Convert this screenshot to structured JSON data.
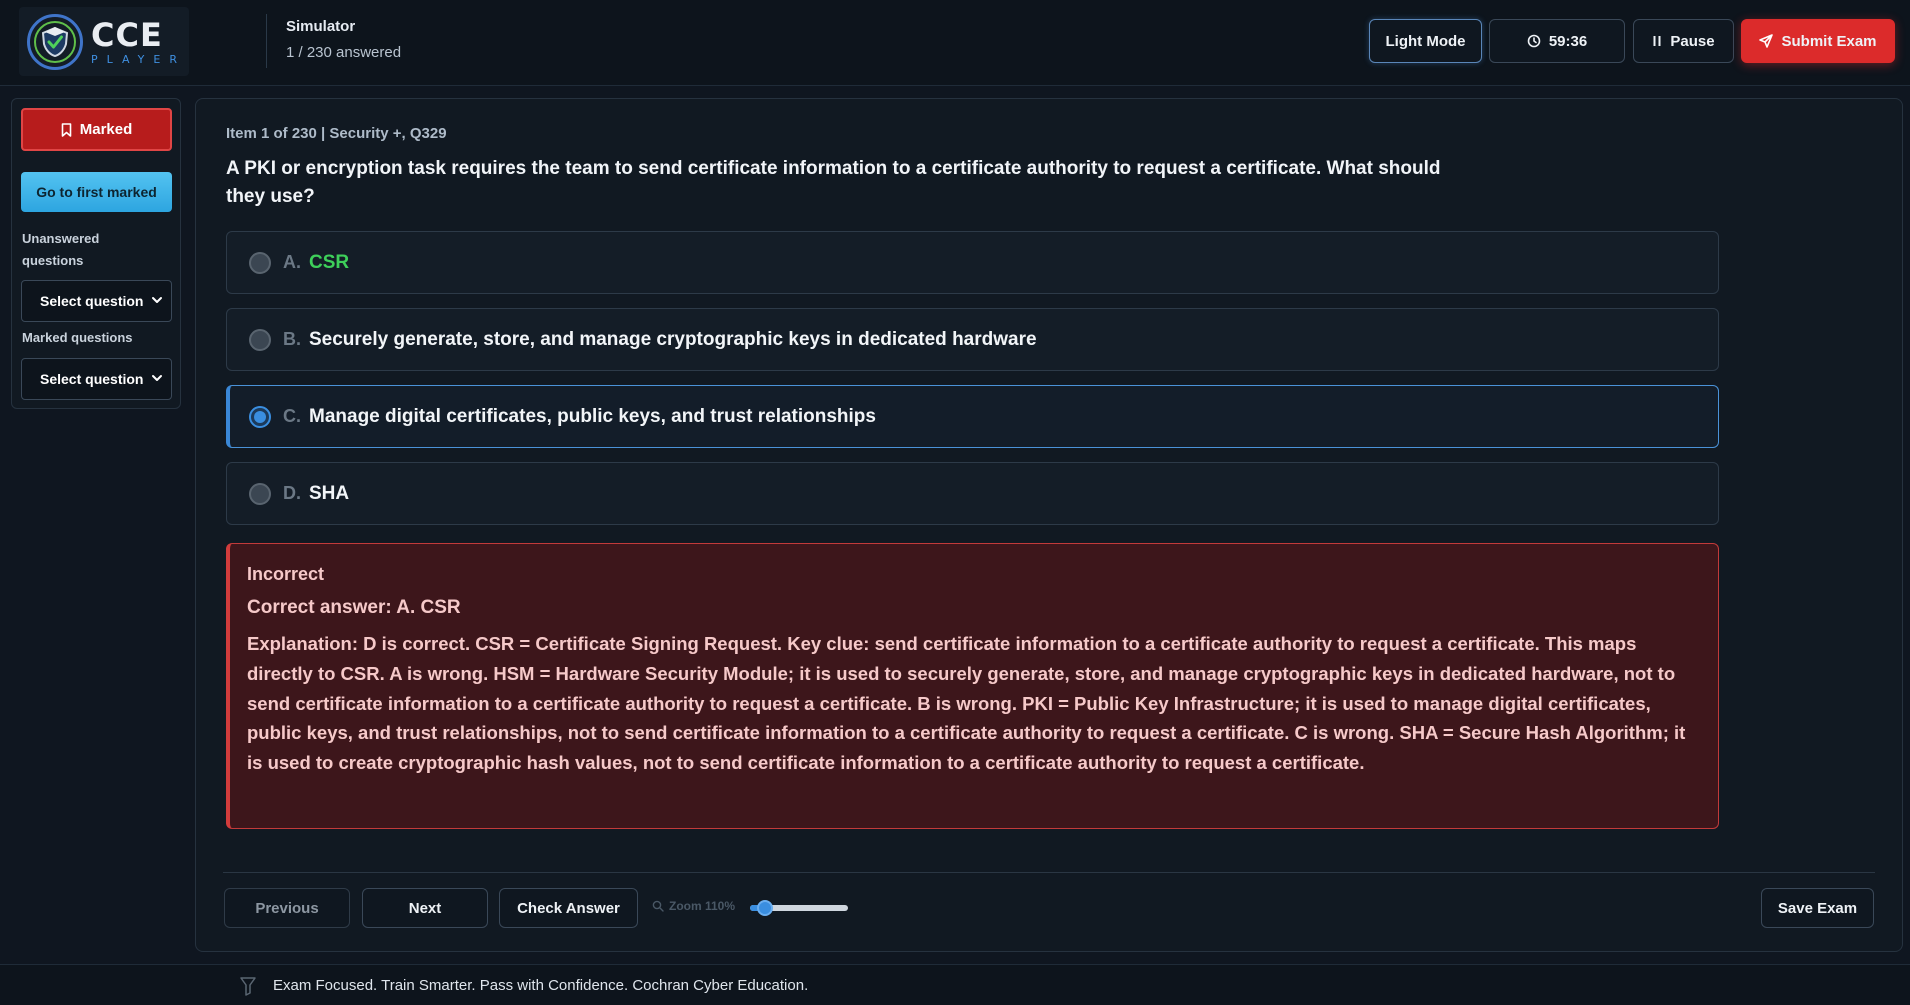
{
  "header": {
    "logo_text": "CCE",
    "logo_subtext": "PLAYER",
    "title": "Simulator",
    "progress": "1 / 230 answered",
    "light_mode_label": "Light Mode",
    "timer": "59:36",
    "pause_label": "Pause",
    "submit_label": "Submit Exam"
  },
  "sidebar": {
    "marked_label": "Marked",
    "first_marked_label": "Go to first marked",
    "unanswered_label": "Unanswered questions",
    "unanswered_select": "Select question",
    "marked_questions_label": "Marked questions",
    "marked_select": "Select question"
  },
  "question": {
    "meta": "Item 1 of 230 | Security +, Q329",
    "text": "A PKI or encryption task requires the team to send certificate information to a certificate authority to request a certificate. What should they use?",
    "options": [
      {
        "letter": "A.",
        "text": "CSR",
        "state": "correct"
      },
      {
        "letter": "B.",
        "text": "Securely generate, store, and manage cryptographic keys in dedicated hardware",
        "state": "normal"
      },
      {
        "letter": "C.",
        "text": "Manage digital certificates, public keys, and trust relationships",
        "state": "selected"
      },
      {
        "letter": "D.",
        "text": "SHA",
        "state": "normal"
      }
    ]
  },
  "feedback": {
    "status": "Incorrect",
    "correct_answer": "Correct answer: A. CSR",
    "explanation": "Explanation: D is correct. CSR = Certificate Signing Request. Key clue: send certificate information to a certificate authority to request a certificate. This maps directly to CSR. A is wrong. HSM = Hardware Security Module; it is used to securely generate, store, and manage cryptographic keys in dedicated hardware, not to send certificate information to a certificate authority to request a certificate. B is wrong. PKI = Public Key Infrastructure; it is used to manage digital certificates, public keys, and trust relationships, not to send certificate information to a certificate authority to request a certificate. C is wrong. SHA = Secure Hash Algorithm; it is used to create cryptographic hash values, not to send certificate information to a certificate authority to request a certificate."
  },
  "footer": {
    "previous_label": "Previous",
    "next_label": "Next",
    "check_label": "Check Answer",
    "zoom_label": "Zoom 110%",
    "zoom_value": 110,
    "save_label": "Save Exam"
  },
  "bottom_bar": {
    "tagline": "Exam Focused. Train Smarter. Pass with Confidence. Cochran Cyber Education."
  },
  "colors": {
    "accent": "#3a8ee0",
    "danger": "#dc2b2b",
    "correct": "#3ecf5a",
    "background": "#0f1620"
  }
}
